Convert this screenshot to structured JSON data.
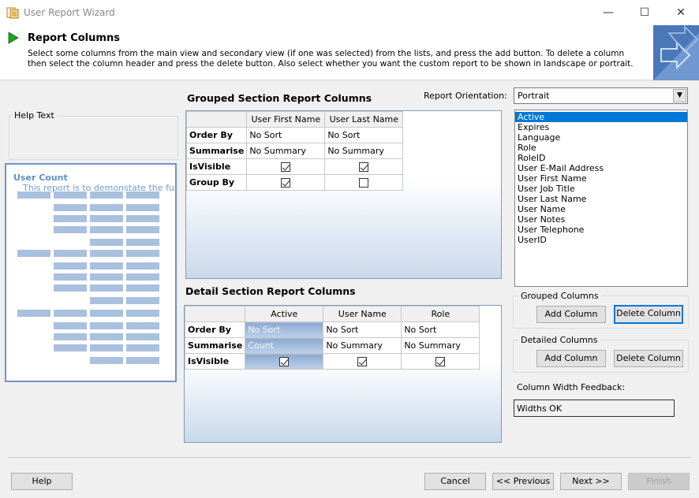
{
  "window": {
    "title": "User Report Wizard",
    "minimize_glyph": "—",
    "maximize_glyph": "☐",
    "close_glyph": "✕"
  },
  "header": {
    "title": "Report Columns",
    "description": "Select some columns from the main view and secondary view (if one was selected) from the lists, and press the add button. To delete a column then select the column header and press the delete button. Also select whether you want the custom report to be shown in landscape or portrait."
  },
  "help": {
    "label": "Help Text"
  },
  "preview": {
    "title": "User Count",
    "subtitle": "This report is to demonstate the fun"
  },
  "grouped": {
    "title": "Grouped Section Report Columns",
    "columns": [
      "User First Name",
      "User Last Name"
    ],
    "row_labels": [
      "Order By",
      "Summarise",
      "IsVisible",
      "Group By"
    ],
    "order_by": [
      "No Sort",
      "No Sort"
    ],
    "summarise": [
      "No Summary",
      "No Summary"
    ],
    "is_visible": [
      true,
      true
    ],
    "group_by": [
      true,
      false
    ]
  },
  "detail": {
    "title": "Detail Section Report Columns",
    "columns": [
      "Active",
      "User Name",
      "Role"
    ],
    "row_labels": [
      "Order By",
      "Summarise",
      "IsVisible"
    ],
    "order_by": [
      "No Sort",
      "No Sort",
      "No Sort"
    ],
    "summarise": [
      "Count",
      "No Summary",
      "No Summary"
    ],
    "is_visible": [
      true,
      true,
      true
    ]
  },
  "orientation": {
    "label": "Report Orientation:",
    "value": "Portrait"
  },
  "column_list": {
    "items": [
      "Active",
      "Expires",
      "Language",
      "Role",
      "RoleID",
      "User E-Mail Address",
      "User First Name",
      "User Job Title",
      "User Last Name",
      "User Name",
      "User Notes",
      "User Telephone",
      "UserID"
    ],
    "selected": "Active"
  },
  "grouped_columns": {
    "label": "Grouped Columns",
    "add_label": "Add Column",
    "delete_label": "Delete Column"
  },
  "detailed_columns": {
    "label": "Detailed Columns",
    "add_label": "Add Column",
    "delete_label": "Delete Column"
  },
  "width_feedback": {
    "label": "Column Width Feedback:",
    "value": "Widths OK"
  },
  "footer": {
    "help_label": "Help",
    "cancel_label": "Cancel",
    "previous_label": "<< Previous",
    "next_label": "Next >>",
    "finish_label": "Finish"
  },
  "colors": {
    "accent": "#0078d7",
    "play_icon": "#22a022",
    "grid_selected": "#8ca8d0"
  }
}
